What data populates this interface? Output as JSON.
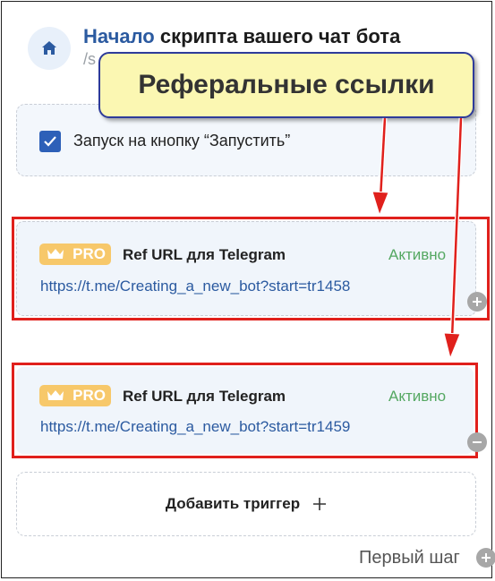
{
  "header": {
    "title_accent": "Начало",
    "title_rest": " скрипта вашего чат бота",
    "subtitle_partial": "/s"
  },
  "callout": {
    "text": "Реферальные ссылки"
  },
  "trigger": {
    "label": "Запуск на кнопку “Запустить”",
    "checked": true
  },
  "ref_links": [
    {
      "badge": "PRO",
      "title": "Ref URL для Telegram",
      "status": "Активно",
      "url": "https://t.me/Creating_a_new_bot?start=tr1458"
    },
    {
      "badge": "PRO",
      "title": "Ref URL для Telegram",
      "status": "Активно",
      "url": "https://t.me/Creating_a_new_bot?start=tr1459"
    }
  ],
  "add_trigger": {
    "label": "Добавить триггер"
  },
  "footer": {
    "next_step_label": "Первый шаг"
  },
  "colors": {
    "accent_blue": "#2b5aa0",
    "status_green": "#55a862",
    "highlight_red": "#e0201c",
    "callout_bg": "#fbf7b2",
    "pro_badge": "#f7c86a"
  }
}
